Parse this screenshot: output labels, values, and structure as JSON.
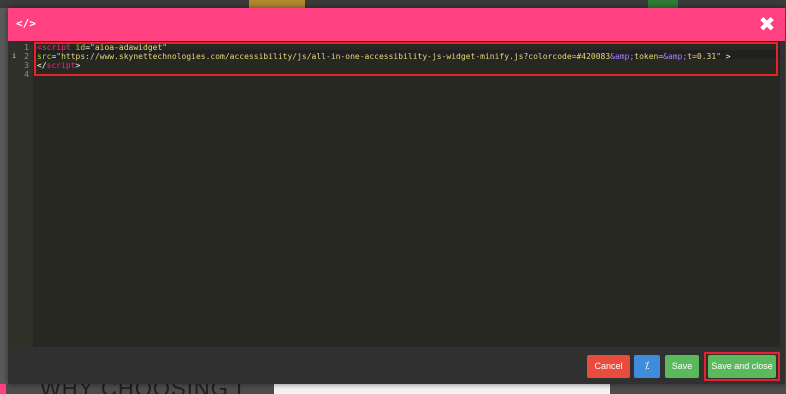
{
  "modal": {
    "title_icon": "</>",
    "close_icon": "✖"
  },
  "editor": {
    "line_numbers": [
      "1",
      "2",
      "3",
      "4"
    ],
    "line1": {
      "open": "<",
      "tag": "script",
      "attr": " id",
      "eq": "=",
      "value": "\"aioa-adawidget\""
    },
    "line2": {
      "attr": "src",
      "eq": "=",
      "value_start": "\"https://www.skynettechnologies.com/accessibility/js/all-in-one-accessibility-js-widget-minify.js?colorcode=#420083",
      "entity1": "&amp;",
      "value_mid": "token=",
      "entity2": "&amp;",
      "value_end": "t=0.31\"",
      "close": " >"
    },
    "line3": {
      "open": "</",
      "tag": "script",
      "close": ">"
    }
  },
  "footer": {
    "cancel_label": "Cancel",
    "magic_icon": "⁒",
    "save_label": "Save",
    "save_close_label": "Save and close"
  },
  "background": {
    "heading": "WHY CHOOSING I"
  },
  "colors": {
    "header": "#ff4081",
    "cancel": "#e74c3c",
    "magic": "#3f8bdc",
    "save": "#5cb85c",
    "highlight": "#e8222a"
  }
}
